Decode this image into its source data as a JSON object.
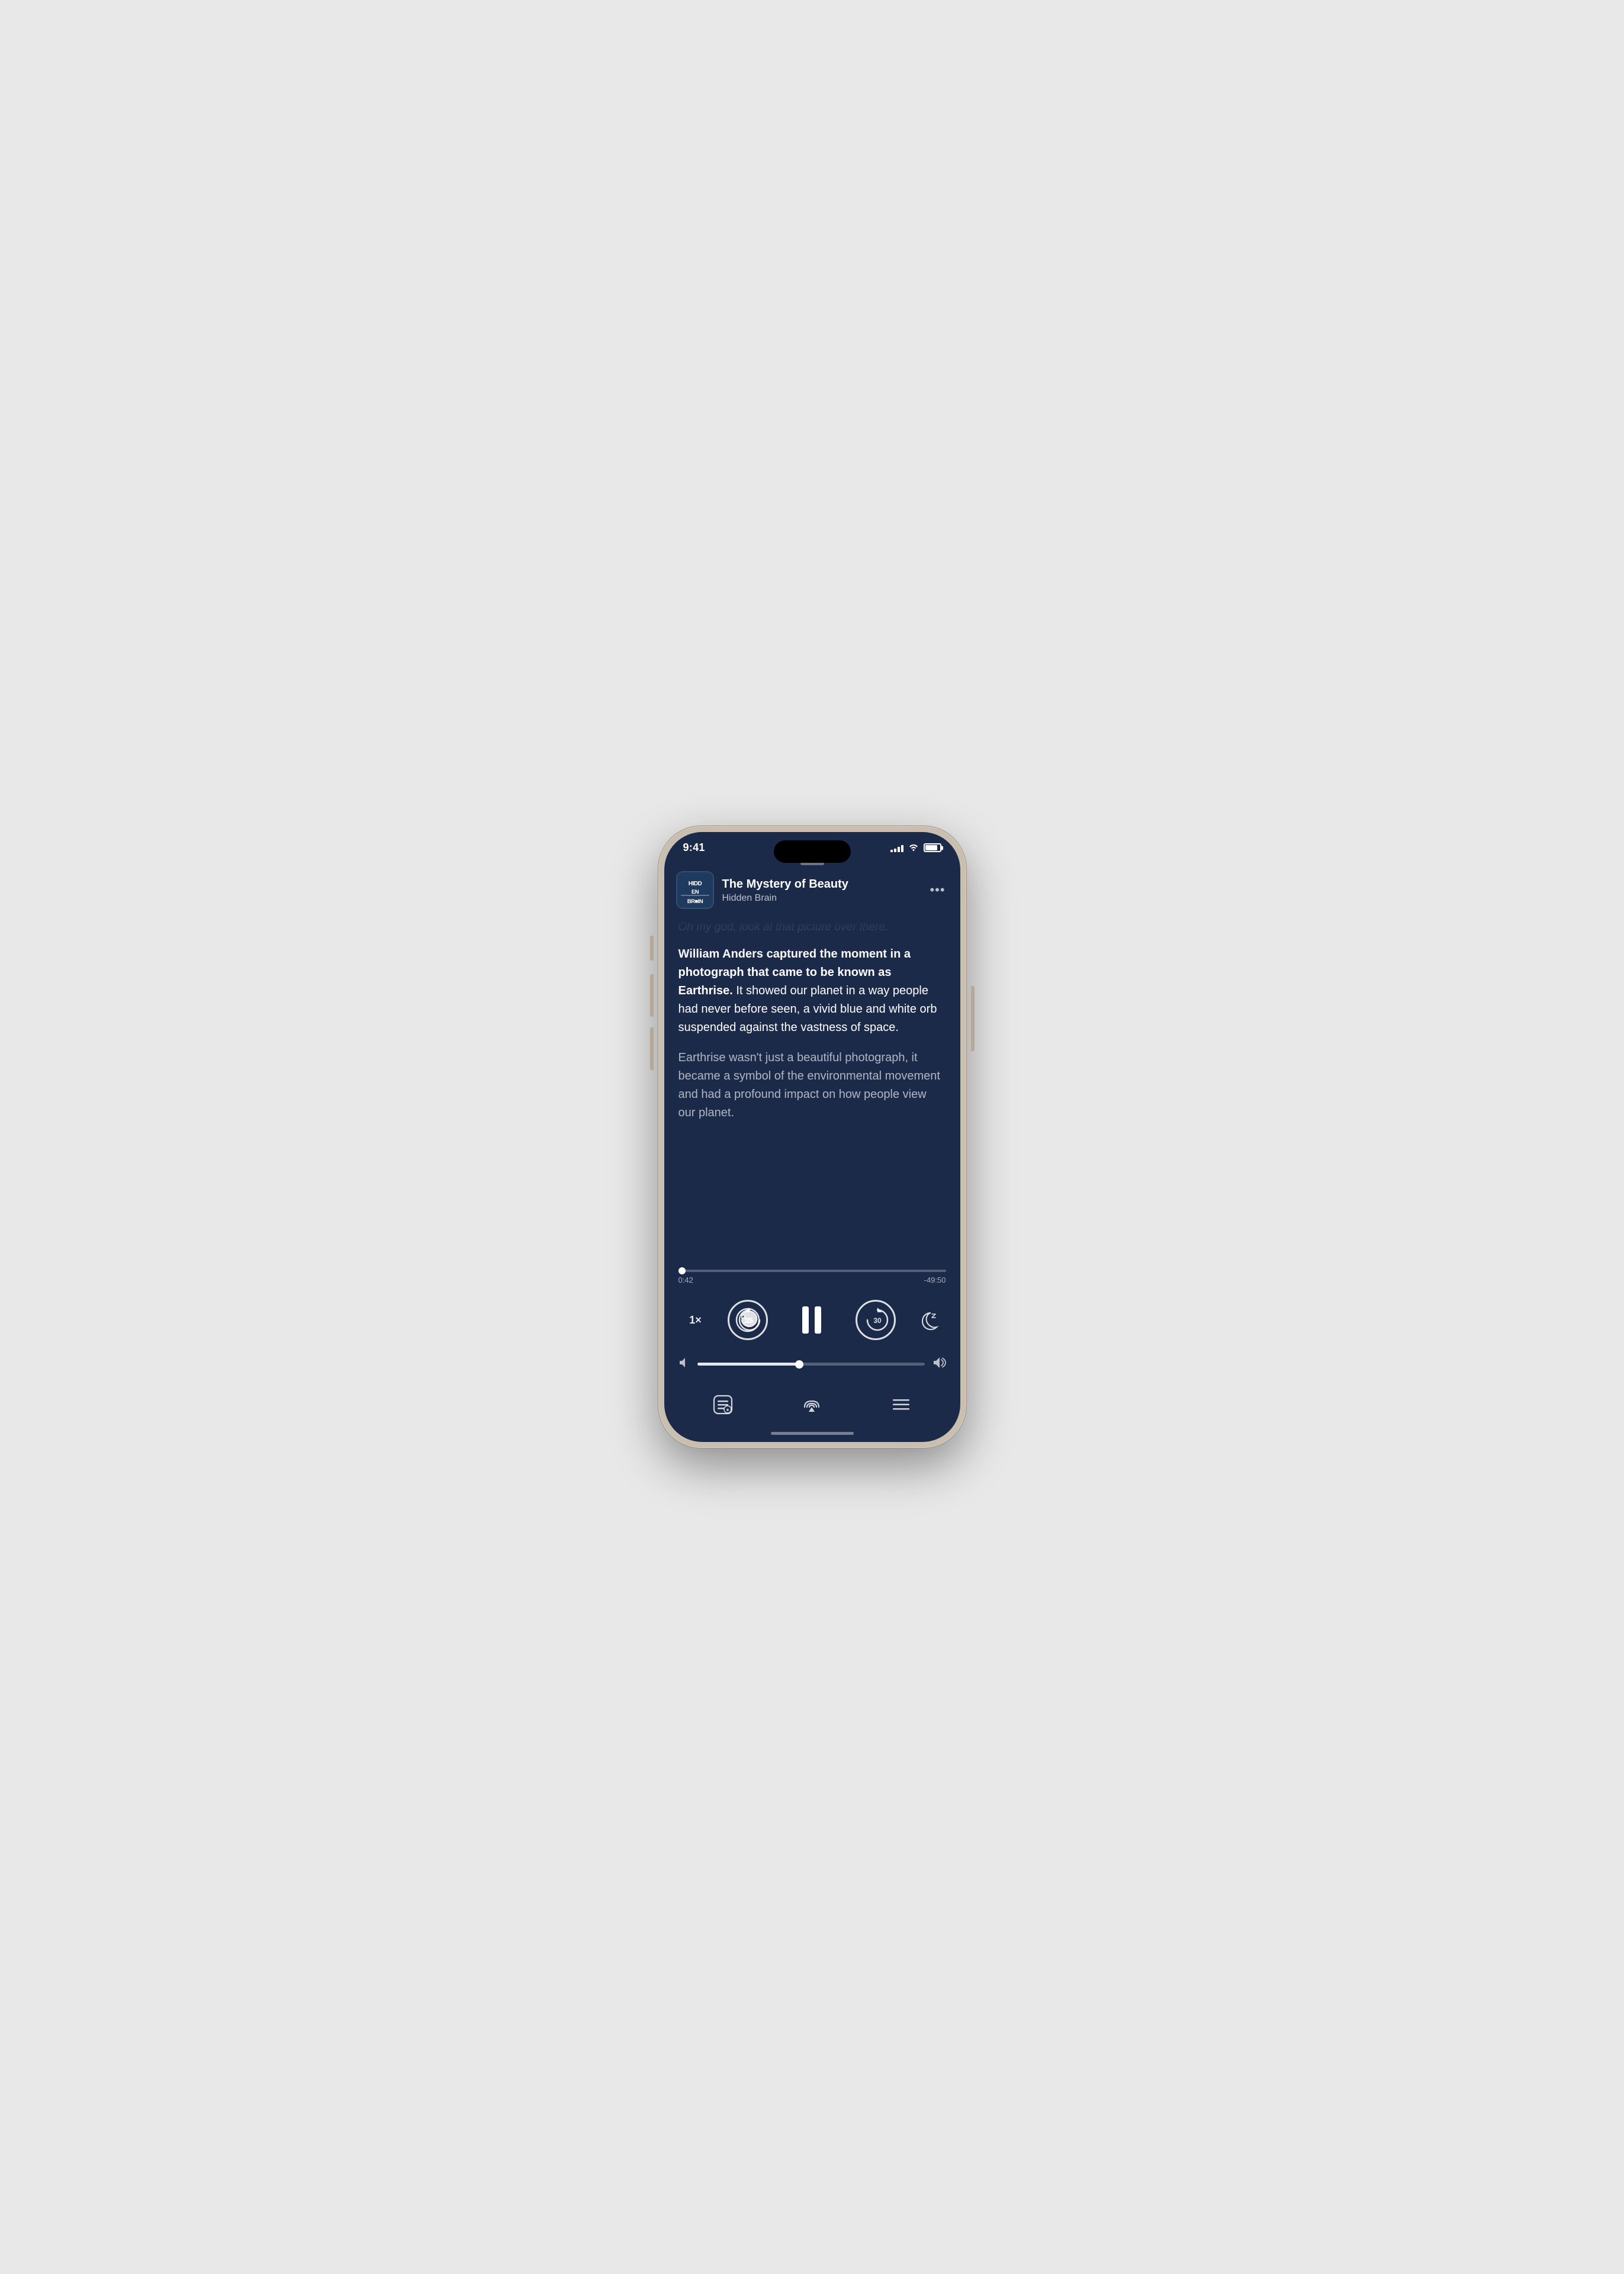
{
  "phone": {
    "status_bar": {
      "time": "9:41",
      "signal_bars": [
        4,
        6,
        8,
        11,
        14
      ],
      "battery_percent": 85
    },
    "podcast": {
      "logo_text": "HIDDΞN\nBRΞIN",
      "title": "The Mystery of Beauty",
      "show": "Hidden Brain",
      "more_label": "•••"
    },
    "transcript": {
      "faded_text": "Oh my god, look at that picture over there.",
      "bold_text": "William Anders captured the moment in a photograph that came to be known as Earthrise.",
      "normal_text": " It showed our planet in a way people had never before seen, a vivid blue and white orb suspended against the vastness of space.",
      "para2": "Earthrise wasn't just a beautiful photograph, it became a symbol of the environmental movement and had a profound impact on how people view our planet."
    },
    "playback": {
      "current_time": "0:42",
      "remaining_time": "-49:50",
      "progress_percent": 1.4
    },
    "controls": {
      "speed_label": "1×",
      "rewind_seconds": "15",
      "forward_seconds": "30",
      "sleep_icon": "sleep"
    },
    "volume": {
      "level_percent": 45
    },
    "bottom_actions": {
      "transcript_icon": "transcript",
      "airplay_icon": "airplay",
      "queue_icon": "queue"
    }
  }
}
